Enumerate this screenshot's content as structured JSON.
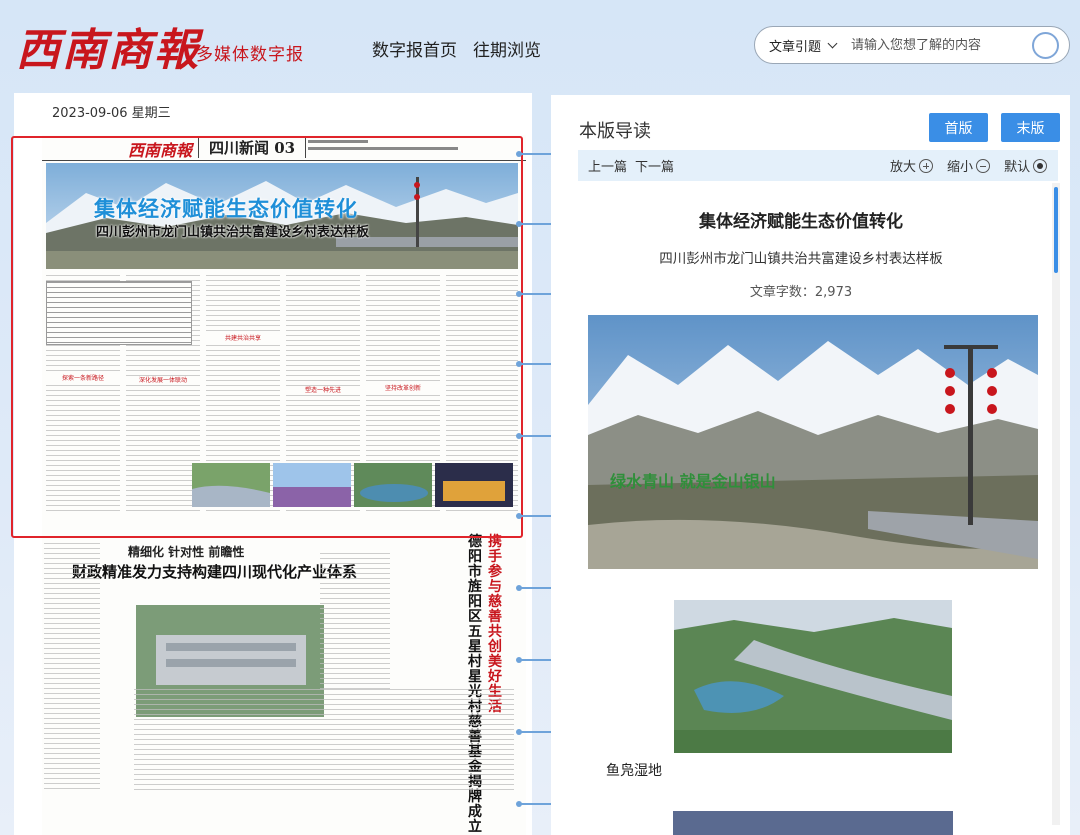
{
  "header": {
    "logo": "西南商報",
    "subtitle": "多媒体数字报",
    "nav": [
      "数字报首页",
      "往期浏览"
    ],
    "search": {
      "type_selected": "文章引题",
      "placeholder": "请输入您想了解的内容"
    }
  },
  "paper": {
    "date": "2023-09-06 星期三",
    "masthead_logo": "西南商報",
    "section": "四川新闻 03",
    "hero_headline": "集体经济赋能生态价值转化",
    "hero_subhead": "四川彭州市龙门山镇共治共富建设乡村表达样板",
    "column_heads": [
      "探索一条新路径",
      "深化发展一体联动",
      "共建共治共享",
      "塑造一种先进",
      "坚持改革创新"
    ],
    "lower_kicker": "精细化 针对性 前瞻性",
    "lower_headline": "财政精准发力支持构建四川现代化产业体系",
    "vertical_title_red": "携手参与慈善 共创美好生活",
    "vertical_title_black": "德阳市旌阳区五星村星光村慈善基金揭牌成立"
  },
  "article": {
    "panel_title": "本版导读",
    "buttons": {
      "first": "首版",
      "last": "末版"
    },
    "toolbar": {
      "prev": "上一篇",
      "next": "下一篇",
      "zoom_in": "放大",
      "zoom_out": "缩小",
      "default": "默认"
    },
    "title": "集体经济赋能生态价值转化",
    "subtitle": "四川彭州市龙门山镇共治共富建设乡村表达样板",
    "word_count": "文章字数：2,973",
    "image_sign": "绿水青山 就是金山银山",
    "caption": "鱼凫湿地"
  },
  "colors": {
    "accent": "#3a8ee6",
    "brand_red": "#c8161d",
    "selection": "#e0242b"
  }
}
